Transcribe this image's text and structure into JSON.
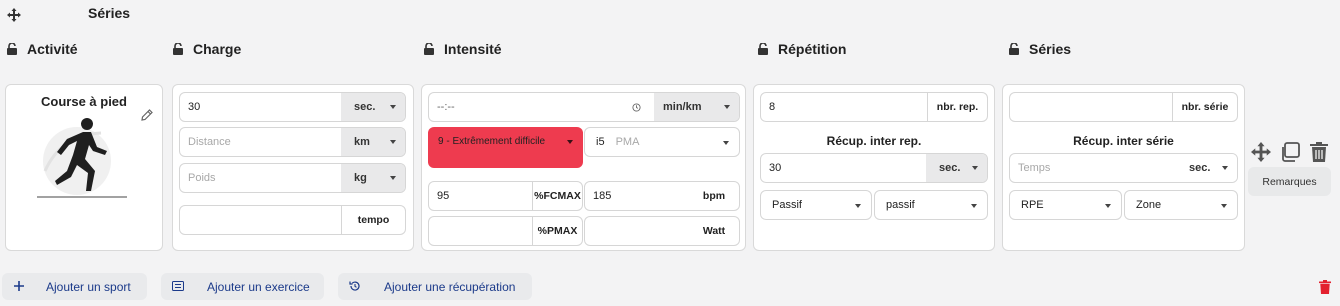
{
  "header": {
    "title": "Séries"
  },
  "columns": {
    "activite": "Activité",
    "charge": "Charge",
    "intensite": "Intensité",
    "repetition": "Répétition",
    "series": "Séries"
  },
  "activity": {
    "name": "Course à pied"
  },
  "charge": {
    "duration_value": "30",
    "duration_unit": "sec.",
    "distance_placeholder": "Distance",
    "distance_unit": "km",
    "weight_placeholder": "Poids",
    "weight_unit": "kg",
    "tempo_value": "",
    "tempo_label": "tempo"
  },
  "intensity": {
    "pace_placeholder": "--:--",
    "pace_unit": "min/km",
    "rpe_selected": "9 - Extrêmement difficile",
    "zone_code": "i5",
    "zone_label": "PMA",
    "fcmax_value": "95",
    "fcmax_unit": "%FCMAX",
    "bpm_value": "185",
    "bpm_unit": "bpm",
    "pmax_value": "",
    "pmax_unit": "%PMAX",
    "watt_value": "",
    "watt_unit": "Watt"
  },
  "repetition": {
    "count_value": "8",
    "count_unit": "nbr. rep.",
    "recovery_title": "Récup. inter rep.",
    "recovery_value": "30",
    "recovery_unit": "sec.",
    "mode_1": "Passif",
    "mode_2": "passif"
  },
  "series": {
    "count_value": "",
    "count_unit": "nbr. série",
    "recovery_title": "Récup. inter série",
    "recovery_placeholder": "Temps",
    "recovery_unit": "sec.",
    "select_1": "RPE",
    "select_2": "Zone"
  },
  "actions": {
    "remarks": "Remarques"
  },
  "footer": {
    "add_sport": "Ajouter un sport",
    "add_exercise": "Ajouter un exercice",
    "add_recovery": "Ajouter une récupération"
  },
  "colors": {
    "rpe_red": "#ee3b4f",
    "link_blue": "#1b3a8a",
    "delete_red": "#e3202e"
  }
}
